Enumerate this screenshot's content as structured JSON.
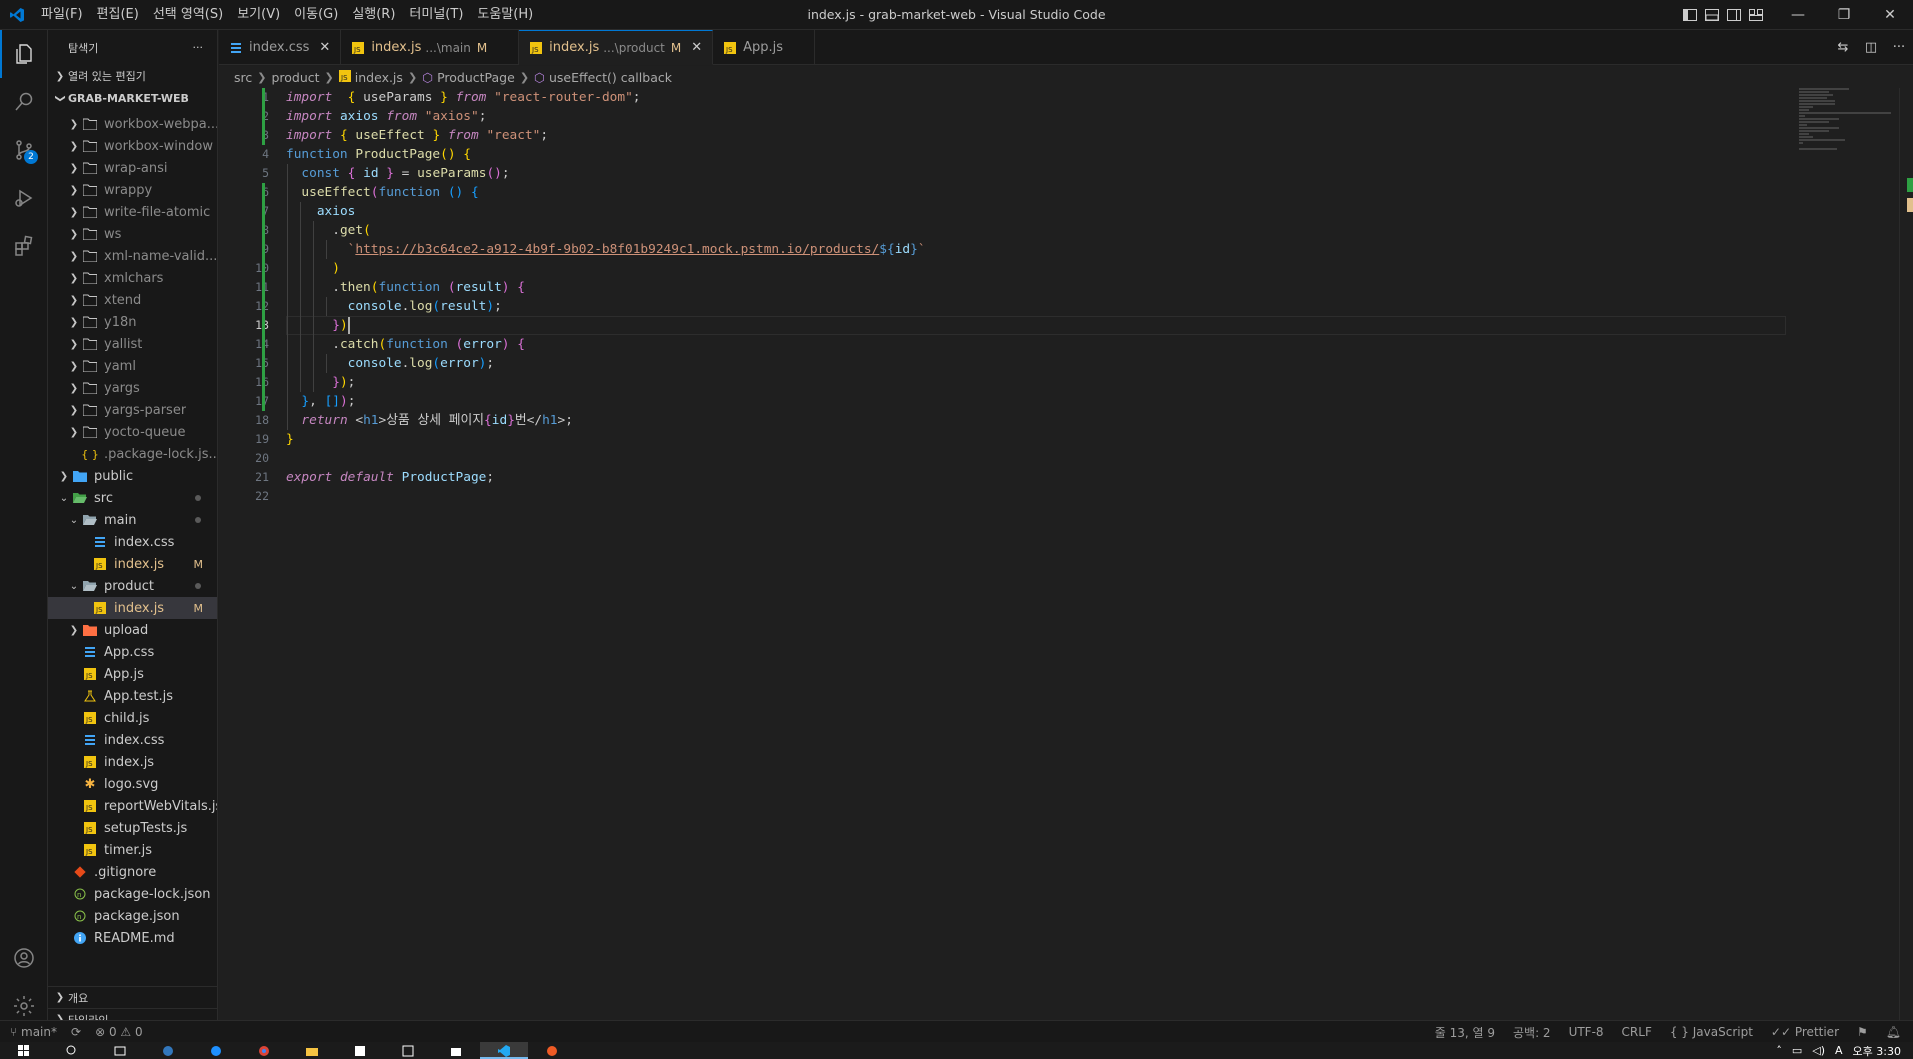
{
  "window": {
    "title": "index.js - grab-market-web - Visual Studio Code",
    "menu": [
      "파일(F)",
      "편집(E)",
      "선택 영역(S)",
      "보기(V)",
      "이동(G)",
      "실행(R)",
      "터미널(T)",
      "도움말(H)"
    ],
    "controls": {
      "minimize": "—",
      "restore": "❐",
      "close": "✕"
    }
  },
  "activity": {
    "scm_badge": "2"
  },
  "sidebar": {
    "title": "탐색기",
    "more": "···",
    "open_editors": "열려 있는 편집기",
    "project": "GRAB-MARKET-WEB",
    "outline": "개요",
    "timeline": "타임라인",
    "tree": [
      {
        "label": "workbox-webpa...",
        "type": "folder",
        "depth": 1,
        "dim": true
      },
      {
        "label": "workbox-window",
        "type": "folder",
        "depth": 1,
        "dim": true
      },
      {
        "label": "wrap-ansi",
        "type": "folder",
        "depth": 1,
        "dim": true
      },
      {
        "label": "wrappy",
        "type": "folder",
        "depth": 1,
        "dim": true
      },
      {
        "label": "write-file-atomic",
        "type": "folder",
        "depth": 1,
        "dim": true
      },
      {
        "label": "ws",
        "type": "folder",
        "depth": 1,
        "dim": true
      },
      {
        "label": "xml-name-valid...",
        "type": "folder",
        "depth": 1,
        "dim": true
      },
      {
        "label": "xmlchars",
        "type": "folder",
        "depth": 1,
        "dim": true
      },
      {
        "label": "xtend",
        "type": "folder",
        "depth": 1,
        "dim": true
      },
      {
        "label": "y18n",
        "type": "folder",
        "depth": 1,
        "dim": true
      },
      {
        "label": "yallist",
        "type": "folder",
        "depth": 1,
        "dim": true
      },
      {
        "label": "yaml",
        "type": "folder",
        "depth": 1,
        "dim": true
      },
      {
        "label": "yargs",
        "type": "folder",
        "depth": 1,
        "dim": true
      },
      {
        "label": "yargs-parser",
        "type": "folder",
        "depth": 1,
        "dim": true
      },
      {
        "label": "yocto-queue",
        "type": "folder",
        "depth": 1,
        "dim": true
      },
      {
        "label": ".package-lock.js...",
        "type": "json",
        "depth": 1,
        "dim": true
      },
      {
        "label": "public",
        "type": "folder-blue",
        "depth": 0
      },
      {
        "label": "src",
        "type": "folder-open-green",
        "depth": 0,
        "open": true,
        "dot": true
      },
      {
        "label": "main",
        "type": "folder-open",
        "depth": 1,
        "open": true,
        "dot": true
      },
      {
        "label": "index.css",
        "type": "css",
        "depth": 2
      },
      {
        "label": "index.js",
        "type": "js",
        "depth": 2,
        "mod": "M"
      },
      {
        "label": "product",
        "type": "folder-open",
        "depth": 1,
        "open": true,
        "dot": true
      },
      {
        "label": "index.js",
        "type": "js",
        "depth": 2,
        "mod": "M",
        "selected": true
      },
      {
        "label": "upload",
        "type": "folder-red",
        "depth": 1
      },
      {
        "label": "App.css",
        "type": "css",
        "depth": 1
      },
      {
        "label": "App.js",
        "type": "js",
        "depth": 1
      },
      {
        "label": "App.test.js",
        "type": "test",
        "depth": 1
      },
      {
        "label": "child.js",
        "type": "js",
        "depth": 1
      },
      {
        "label": "index.css",
        "type": "css",
        "depth": 1
      },
      {
        "label": "index.js",
        "type": "js",
        "depth": 1
      },
      {
        "label": "logo.svg",
        "type": "svg",
        "depth": 1
      },
      {
        "label": "reportWebVitals.js",
        "type": "js",
        "depth": 1
      },
      {
        "label": "setupTests.js",
        "type": "js",
        "depth": 1
      },
      {
        "label": "timer.js",
        "type": "js",
        "depth": 1
      },
      {
        "label": ".gitignore",
        "type": "git",
        "depth": 0
      },
      {
        "label": "package-lock.json",
        "type": "npm",
        "depth": 0
      },
      {
        "label": "package.json",
        "type": "npm",
        "depth": 0
      },
      {
        "label": "README.md",
        "type": "info",
        "depth": 0
      }
    ]
  },
  "tabs": [
    {
      "label": "index.css",
      "icon": "css",
      "desc": "",
      "mod": "",
      "close": "✕"
    },
    {
      "label": "index.js",
      "icon": "js",
      "desc": "...\\main",
      "mod": "M",
      "close": ""
    },
    {
      "label": "index.js",
      "icon": "js",
      "desc": "...\\product",
      "mod": "M",
      "close": "✕",
      "active": true
    },
    {
      "label": "App.js",
      "icon": "js",
      "desc": "",
      "mod": "",
      "close": ""
    }
  ],
  "breadcrumb": [
    "src",
    "product",
    "index.js",
    "ProductPage",
    "useEffect() callback"
  ],
  "editor": {
    "current_line": 13,
    "lines": [
      [
        [
          "k",
          "import"
        ],
        [
          "",
          "  "
        ],
        [
          "p",
          "{"
        ],
        [
          "",
          " useParams "
        ],
        [
          "p",
          "}"
        ],
        [
          "",
          " "
        ],
        [
          "k",
          "from"
        ],
        [
          "",
          " "
        ],
        [
          "s",
          "\"react-router-dom\""
        ],
        [
          "",
          ";"
        ]
      ],
      [
        [
          "k",
          "import"
        ],
        [
          "",
          " "
        ],
        [
          "v",
          "axios"
        ],
        [
          "",
          " "
        ],
        [
          "k",
          "from"
        ],
        [
          "",
          " "
        ],
        [
          "s",
          "\"axios\""
        ],
        [
          "",
          ";"
        ]
      ],
      [
        [
          "k",
          "import"
        ],
        [
          "",
          " "
        ],
        [
          "p",
          "{"
        ],
        [
          "",
          " "
        ],
        [
          "fn",
          "useEffect"
        ],
        [
          "",
          " "
        ],
        [
          "p",
          "}"
        ],
        [
          "",
          " "
        ],
        [
          "k",
          "from"
        ],
        [
          "",
          " "
        ],
        [
          "s",
          "\"react\""
        ],
        [
          "",
          ";"
        ]
      ],
      [
        [
          "kw",
          "function"
        ],
        [
          "",
          " "
        ],
        [
          "fn",
          "ProductPage"
        ],
        [
          "p",
          "()"
        ],
        [
          "",
          " "
        ],
        [
          "p",
          "{"
        ]
      ],
      [
        [
          "",
          "  "
        ],
        [
          "kw",
          "const"
        ],
        [
          "",
          " "
        ],
        [
          "p2",
          "{"
        ],
        [
          "",
          " "
        ],
        [
          "v",
          "id"
        ],
        [
          "",
          " "
        ],
        [
          "p2",
          "}"
        ],
        [
          "",
          " = "
        ],
        [
          "fn",
          "useParams"
        ],
        [
          "p2",
          "()"
        ],
        [
          "",
          ";"
        ]
      ],
      [
        [
          "",
          "  "
        ],
        [
          "fn",
          "useEffect"
        ],
        [
          "p2",
          "("
        ],
        [
          "kw",
          "function"
        ],
        [
          "",
          " "
        ],
        [
          "p3",
          "()"
        ],
        [
          "",
          " "
        ],
        [
          "p3",
          "{"
        ]
      ],
      [
        [
          "",
          "    "
        ],
        [
          "v",
          "axios"
        ]
      ],
      [
        [
          "",
          "      ."
        ],
        [
          "fn",
          "get"
        ],
        [
          "p",
          "("
        ]
      ],
      [
        [
          "",
          "        "
        ],
        [
          "tmpl",
          "`"
        ],
        [
          "url",
          "https://b3c64ce2-a912-4b9f-9b02-b8f01b9249c1.mock.pstmn.io/products/"
        ],
        [
          "kw",
          "${"
        ],
        [
          "v",
          "id"
        ],
        [
          "kw",
          "}"
        ],
        [
          "tmpl",
          "`"
        ]
      ],
      [
        [
          "",
          "      "
        ],
        [
          "p",
          ")"
        ]
      ],
      [
        [
          "",
          "      ."
        ],
        [
          "fn",
          "then"
        ],
        [
          "p",
          "("
        ],
        [
          "kw",
          "function"
        ],
        [
          "",
          " "
        ],
        [
          "p2",
          "("
        ],
        [
          "v",
          "result"
        ],
        [
          "p2",
          ")"
        ],
        [
          "",
          " "
        ],
        [
          "p2",
          "{"
        ]
      ],
      [
        [
          "",
          "        "
        ],
        [
          "v",
          "console"
        ],
        [
          "",
          "."
        ],
        [
          "fn",
          "log"
        ],
        [
          "p3",
          "("
        ],
        [
          "v",
          "result"
        ],
        [
          "p3",
          ")"
        ],
        [
          "",
          ";"
        ]
      ],
      [
        [
          "",
          "      "
        ],
        [
          "p2",
          "}"
        ],
        [
          "p",
          ")"
        ]
      ],
      [
        [
          "",
          "      ."
        ],
        [
          "fn",
          "catch"
        ],
        [
          "p",
          "("
        ],
        [
          "kw",
          "function"
        ],
        [
          "",
          " "
        ],
        [
          "p2",
          "("
        ],
        [
          "v",
          "error"
        ],
        [
          "p2",
          ")"
        ],
        [
          "",
          " "
        ],
        [
          "p2",
          "{"
        ]
      ],
      [
        [
          "",
          "        "
        ],
        [
          "v",
          "console"
        ],
        [
          "",
          "."
        ],
        [
          "fn",
          "log"
        ],
        [
          "p3",
          "("
        ],
        [
          "v",
          "error"
        ],
        [
          "p3",
          ")"
        ],
        [
          "",
          ";"
        ]
      ],
      [
        [
          "",
          "      "
        ],
        [
          "p2",
          "}"
        ],
        [
          "p",
          ")"
        ],
        [
          "",
          ";"
        ]
      ],
      [
        [
          "",
          "  "
        ],
        [
          "p3",
          "}"
        ],
        [
          "",
          ", "
        ],
        [
          "p3",
          "[]"
        ],
        [
          "p2",
          ")"
        ],
        [
          "",
          ";"
        ]
      ],
      [
        [
          "",
          "  "
        ],
        [
          "k",
          "return"
        ],
        [
          "",
          " "
        ],
        [
          "",
          "<"
        ],
        [
          "tag",
          "h1"
        ],
        [
          "",
          ">상품 상세 페이지"
        ],
        [
          "p2",
          "{"
        ],
        [
          "v",
          "id"
        ],
        [
          "p2",
          "}"
        ],
        [
          "",
          "번</"
        ],
        [
          "tag",
          "h1"
        ],
        [
          "",
          ">;"
        ]
      ],
      [
        [
          "p",
          "}"
        ]
      ],
      [
        [
          "",
          ""
        ]
      ],
      [
        [
          "k",
          "export"
        ],
        [
          "",
          " "
        ],
        [
          "k",
          "default"
        ],
        [
          "",
          " "
        ],
        [
          "v",
          "ProductPage"
        ],
        [
          "",
          ";"
        ]
      ],
      [
        [
          "",
          ""
        ]
      ]
    ]
  },
  "status": {
    "branch": "main*",
    "errors": "0",
    "warnings": "0",
    "position": "줄 13, 열 9",
    "spaces": "공백: 2",
    "encoding": "UTF-8",
    "eol": "CRLF",
    "language": "JavaScript",
    "formatter": "Prettier"
  },
  "taskbar": {
    "clock": "오후 3:30"
  }
}
